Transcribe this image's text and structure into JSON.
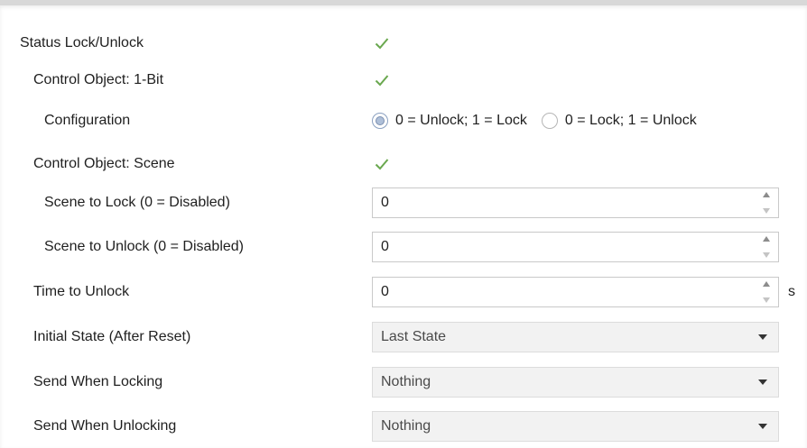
{
  "rows": {
    "status_lock": {
      "label": "Status Lock/Unlock",
      "checked": true
    },
    "control_1bit": {
      "label": "Control Object: 1-Bit",
      "checked": true
    },
    "configuration": {
      "label": "Configuration",
      "options": [
        {
          "label": "0 = Unlock; 1 = Lock",
          "selected": true
        },
        {
          "label": "0 = Lock; 1 = Unlock",
          "selected": false
        }
      ]
    },
    "control_scene": {
      "label": "Control Object: Scene",
      "checked": true
    },
    "scene_lock": {
      "label": "Scene to Lock (0 = Disabled)",
      "value": "0"
    },
    "scene_unlock": {
      "label": "Scene to Unlock (0 = Disabled)",
      "value": "0"
    },
    "time_unlock": {
      "label": "Time to Unlock",
      "value": "0",
      "unit": "s"
    },
    "initial_state": {
      "label": "Initial State (After Reset)",
      "value": "Last State"
    },
    "send_locking": {
      "label": "Send When Locking",
      "value": "Nothing"
    },
    "send_unlocking": {
      "label": "Send When Unlocking",
      "value": "Nothing"
    }
  },
  "colors": {
    "check": "#6aa84f",
    "radio_selected": "#aebfd8",
    "select_bg": "#f2f2f2"
  },
  "icons": {
    "check": "checkmark-icon",
    "spinner": "spinner-arrows-icon",
    "dropdown": "chevron-down-icon"
  }
}
